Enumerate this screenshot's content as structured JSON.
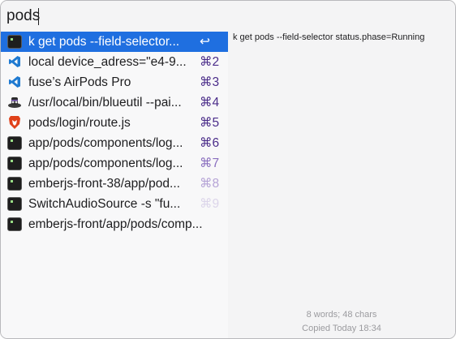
{
  "search": {
    "value": "pods"
  },
  "items": [
    {
      "icon": "terminal-icon",
      "text": "k get pods --field-selector...",
      "key": "↩",
      "key_color": "#ffffff"
    },
    {
      "icon": "vscode-icon",
      "text": "local device_adress=\"e4-9...",
      "key": "⌘2",
      "key_color": "#4b2d8a"
    },
    {
      "icon": "vscode-icon",
      "text": "fuse’s AirPods Pro",
      "key": "⌘3",
      "key_color": "#4b2d8a"
    },
    {
      "icon": "blueutil-icon",
      "text": "/usr/local/bin/blueutil --pai...",
      "key": "⌘4",
      "key_color": "#4b2d8a"
    },
    {
      "icon": "brave-icon",
      "text": "pods/login/route.js",
      "key": "⌘5",
      "key_color": "#4b2d8a"
    },
    {
      "icon": "terminal-icon",
      "text": "app/pods/components/log...",
      "key": "⌘6",
      "key_color": "#4b2d8a"
    },
    {
      "icon": "terminal-icon",
      "text": "app/pods/components/log...",
      "key": "⌘7",
      "key_color": "#8a6fbf"
    },
    {
      "icon": "terminal-icon",
      "text": "emberjs-front-38/app/pod...",
      "key": "⌘8",
      "key_color": "#b5a3d6"
    },
    {
      "icon": "terminal-icon",
      "text": "SwitchAudioSource -s \"fu...",
      "key": "⌘9",
      "key_color": "#dcd5ea"
    },
    {
      "icon": "terminal-icon",
      "text": "emberjs-front/app/pods/comp...",
      "key": "",
      "key_color": "#ffffff"
    }
  ],
  "preview": {
    "text": "k get pods --field-selector status.phase=Running",
    "stats": "8 words; 48 chars",
    "copied": "Copied Today 18:34"
  },
  "colors": {
    "selection": "#1f6fe0",
    "vscode": "#1f7ad1",
    "brave": "#e0411a"
  }
}
